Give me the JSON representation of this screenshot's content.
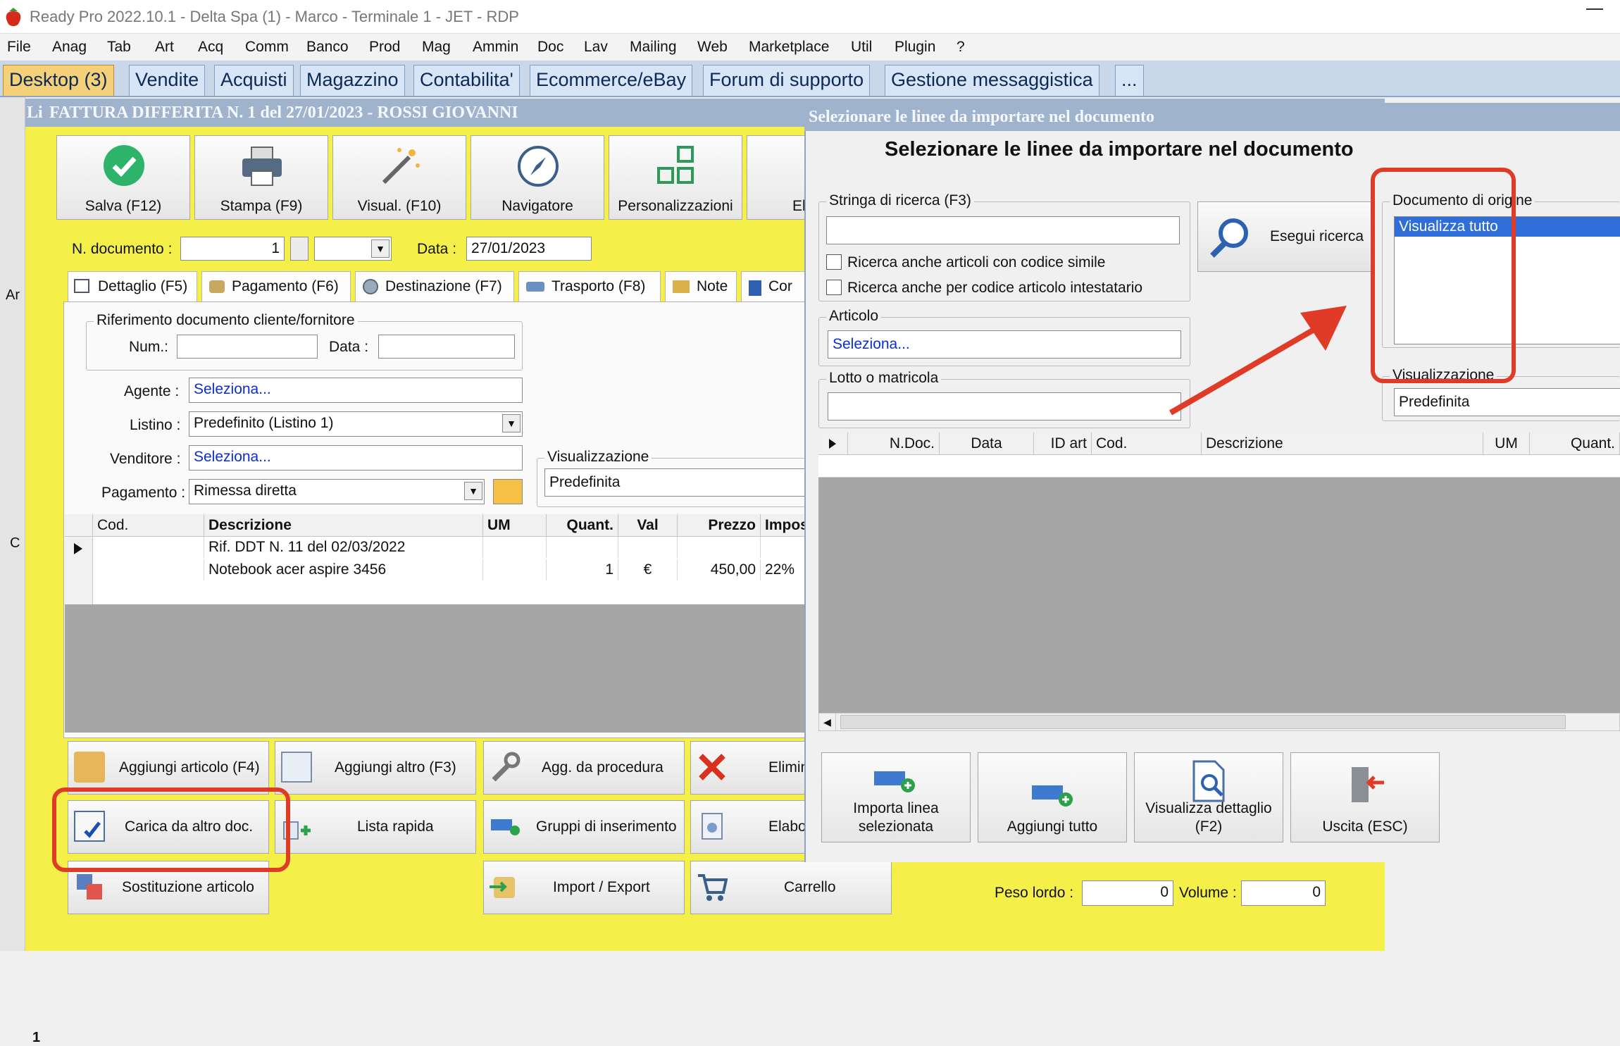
{
  "window": {
    "title": "Ready Pro 2022.10.1 - Delta Spa (1) - Marco - Terminale 1 - JET - RDP"
  },
  "menu": [
    "File",
    "Anag",
    "Tab",
    "Art",
    "Acq",
    "Comm",
    "Banco",
    "Prod",
    "Mag",
    "Ammin",
    "Doc",
    "Lav",
    "Mailing",
    "Web",
    "Marketplace",
    "Util",
    "Plugin",
    "?"
  ],
  "tabs": [
    "Desktop (3)",
    "Vendite",
    "Acquisti",
    "Magazzino",
    "Contabilita'",
    "Ecommerce/eBay",
    "Forum di supporto",
    "Gestione messaggistica",
    "..."
  ],
  "left_labels": {
    "li": "Li",
    "ar": "Ar",
    "c": "C",
    "num": "1"
  },
  "invoice": {
    "title": "FATTURA DIFFERITA N. 1 del 27/01/2023 - ROSSI GIOVANNI",
    "toolbar": {
      "save": "Salva (F12)",
      "print": "Stampa (F9)",
      "view": "Visual. (F10)",
      "navigator": "Navigatore",
      "custom": "Personalizzazioni",
      "el": "El"
    },
    "ndoc_label": "N. documento :",
    "ndoc_value": "1",
    "data_label": "Data :",
    "data_value": "27/01/2023",
    "subtabs": [
      "Dettaglio (F5)",
      "Pagamento (F6)",
      "Destinazione (F7)",
      "Trasporto (F8)",
      "Note",
      "Cor"
    ],
    "ref_group": "Riferimento documento cliente/fornitore",
    "num_label": "Num.:",
    "ref_data_label": "Data :",
    "agente_label": "Agente :",
    "agente_value": "Seleziona...",
    "listino_label": "Listino :",
    "listino_value": "Predefinito (Listino 1)",
    "venditore_label": "Venditore :",
    "venditore_value": "Seleziona...",
    "pagamento_label": "Pagamento :",
    "pagamento_value": "Rimessa diretta",
    "visual_group": "Visualizzazione",
    "visual_value": "Predefinita",
    "grid_headers": [
      "Cod.",
      "Descrizione",
      "UM",
      "Quant.",
      "Val",
      "Prezzo",
      "Imposte"
    ],
    "rows": [
      {
        "cod": "",
        "desc": "Rif. DDT N. 11 del 02/03/2022",
        "um": "",
        "quant": "",
        "val": "",
        "prezzo": "",
        "imp": ""
      },
      {
        "cod": "",
        "desc": "Notebook acer aspire 3456",
        "um": "",
        "quant": "1",
        "val": "€",
        "prezzo": "450,00",
        "imp": "22%"
      }
    ],
    "buttons": {
      "add_article": "Aggiungi articolo (F4)",
      "add_other": "Aggiungi altro (F3)",
      "add_proc": "Agg. da procedura",
      "delete": "Elimin",
      "load_other": "Carica da altro doc.",
      "quick_list": "Lista rapida",
      "insert_groups": "Gruppi di inserimento",
      "elab": "Elabo",
      "replace": "Sostituzione articolo",
      "import_export": "Import / Export",
      "cart": "Carrello"
    },
    "peso_label": "Peso lordo :",
    "peso_value": "0",
    "volume_label": "Volume :",
    "volume_value": "0"
  },
  "dialog": {
    "window_title": "Selezionare le linee da importare nel documento",
    "heading": "Selezionare le linee da importare nel documento",
    "search_group": "Stringa di ricerca (F3)",
    "search_value": "",
    "chk1": "Ricerca anche articoli con codice simile",
    "chk2": "Ricerca anche per codice articolo intestatario",
    "search_button": "Esegui ricerca",
    "articolo_group": "Articolo",
    "articolo_value": "Seleziona...",
    "lotto_group": "Lotto o matricola",
    "origin_group": "Documento di origine",
    "origin_item": "Visualizza tutto",
    "visual_group": "Visualizzazione",
    "visual_value": "Predefinita",
    "grid_headers": [
      "N.Doc.",
      "Data",
      "ID art",
      "Cod.",
      "Descrizione",
      "UM",
      "Quant."
    ],
    "buttons": {
      "import_line": "Importa linea selezionata",
      "add_all": "Aggiungi tutto",
      "view_detail": "Visualizza dettaglio (F2)",
      "exit": "Uscita (ESC)"
    }
  },
  "colors": {
    "accent_red": "#e03b27",
    "form_yellow": "#f5ef49",
    "title_blue": "#9fb3cd",
    "selection_blue": "#2f6ed8"
  }
}
